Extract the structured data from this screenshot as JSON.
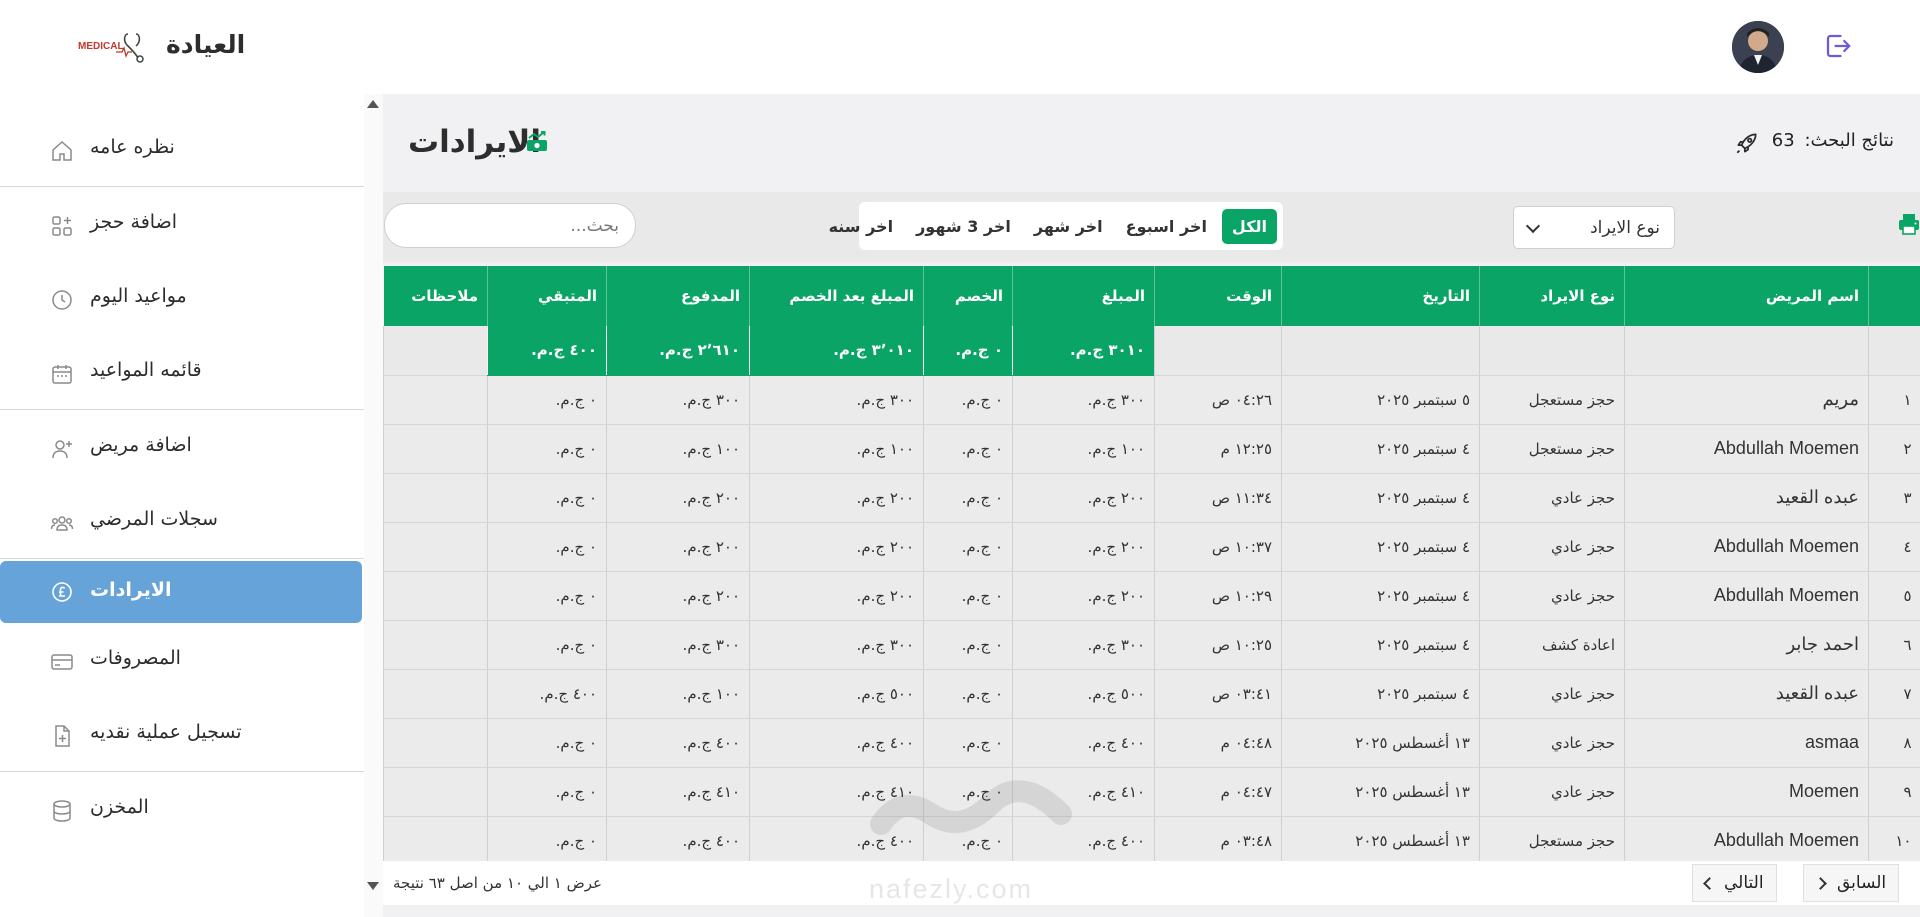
{
  "header": {
    "brand_name": "العيادة",
    "logo_text": "MEDICAL",
    "icons": {
      "logout": "logout-icon",
      "avatar": "user-avatar"
    }
  },
  "sidebar": {
    "items": [
      {
        "label": "نظره عامه",
        "icon": "home-icon"
      },
      {
        "label": "اضافة حجز",
        "icon": "grid-plus-icon"
      },
      {
        "label": "مواعيد اليوم",
        "icon": "clock-icon"
      },
      {
        "label": "قائمه المواعيد",
        "icon": "calendar-icon"
      },
      {
        "label": "اضافة مريض",
        "icon": "user-plus-icon"
      },
      {
        "label": "سجلات المرضي",
        "icon": "users-icon"
      },
      {
        "label": "الايرادات",
        "icon": "pound-coin-icon",
        "active": true
      },
      {
        "label": "المصروفات",
        "icon": "card-icon"
      },
      {
        "label": "تسجيل عملية نقديه",
        "icon": "file-plus-icon"
      },
      {
        "label": "المخزن",
        "icon": "database-icon"
      }
    ]
  },
  "main": {
    "title": "الايرادات",
    "results_label": "نتائج البحث:",
    "results_count": "63",
    "search_placeholder": "بحث...",
    "filters": [
      "الكل",
      "اخر اسبوع",
      "اخر شهر",
      "اخر 3 شهور",
      "اخر سنه"
    ],
    "active_filter": "الكل",
    "type_select": "نوع الايراد",
    "table": {
      "columns": [
        "",
        "اسم المريض",
        "نوع الايراد",
        "التاريخ",
        "الوقت",
        "المبلغ",
        "الخصم",
        "المبلغ بعد الخصم",
        "المدفوع",
        "المتبقي",
        "ملاحظات"
      ],
      "totals": {
        "amount": "٣٠١٠ ج.م.",
        "discount": "٠ ج.م.",
        "after_discount": "٣٬٠١٠ ج.م.",
        "paid": "٢٬٦١٠ ج.م.",
        "remaining": "٤٠٠ ج.م."
      },
      "rows": [
        {
          "idx": "١",
          "name": "مريم",
          "type": "حجز مستعجل",
          "date": "٥ سبتمبر ٢٠٢٥",
          "time": "٠٤:٢٦ ص",
          "amount": "٣٠٠ ج.م.",
          "discount": "٠ ج.م.",
          "after": "٣٠٠ ج.م.",
          "paid": "٣٠٠ ج.م.",
          "remaining": "٠ ج.م.",
          "notes": ""
        },
        {
          "idx": "٢",
          "name": "Abdullah Moemen",
          "type": "حجز مستعجل",
          "date": "٤ سبتمبر ٢٠٢٥",
          "time": "١٢:٢٥ م",
          "amount": "١٠٠ ج.م.",
          "discount": "٠ ج.م.",
          "after": "١٠٠ ج.م.",
          "paid": "١٠٠ ج.م.",
          "remaining": "٠ ج.م.",
          "notes": ""
        },
        {
          "idx": "٣",
          "name": "عبده القعيد",
          "type": "حجز عادي",
          "date": "٤ سبتمبر ٢٠٢٥",
          "time": "١١:٣٤ ص",
          "amount": "٢٠٠ ج.م.",
          "discount": "٠ ج.م.",
          "after": "٢٠٠ ج.م.",
          "paid": "٢٠٠ ج.م.",
          "remaining": "٠ ج.م.",
          "notes": ""
        },
        {
          "idx": "٤",
          "name": "Abdullah Moemen",
          "type": "حجز عادي",
          "date": "٤ سبتمبر ٢٠٢٥",
          "time": "١٠:٣٧ ص",
          "amount": "٢٠٠ ج.م.",
          "discount": "٠ ج.م.",
          "after": "٢٠٠ ج.م.",
          "paid": "٢٠٠ ج.م.",
          "remaining": "٠ ج.م.",
          "notes": ""
        },
        {
          "idx": "٥",
          "name": "Abdullah Moemen",
          "type": "حجز عادي",
          "date": "٤ سبتمبر ٢٠٢٥",
          "time": "١٠:٢٩ ص",
          "amount": "٢٠٠ ج.م.",
          "discount": "٠ ج.م.",
          "after": "٢٠٠ ج.م.",
          "paid": "٢٠٠ ج.م.",
          "remaining": "٠ ج.م.",
          "notes": ""
        },
        {
          "idx": "٦",
          "name": "احمد جابر",
          "type": "اعادة كشف",
          "date": "٤ سبتمبر ٢٠٢٥",
          "time": "١٠:٢٥ ص",
          "amount": "٣٠٠ ج.م.",
          "discount": "٠ ج.م.",
          "after": "٣٠٠ ج.م.",
          "paid": "٣٠٠ ج.م.",
          "remaining": "٠ ج.م.",
          "notes": ""
        },
        {
          "idx": "٧",
          "name": "عبده القعيد",
          "type": "حجز عادي",
          "date": "٤ سبتمبر ٢٠٢٥",
          "time": "٠٣:٤١ ص",
          "amount": "٥٠٠ ج.م.",
          "discount": "٠ ج.م.",
          "after": "٥٠٠ ج.م.",
          "paid": "١٠٠ ج.م.",
          "remaining": "٤٠٠ ج.م.",
          "notes": ""
        },
        {
          "idx": "٨",
          "name": "asmaa",
          "type": "حجز عادي",
          "date": "١٣ أغسطس ٢٠٢٥",
          "time": "٠٤:٤٨ م",
          "amount": "٤٠٠ ج.م.",
          "discount": "٠ ج.م.",
          "after": "٤٠٠ ج.م.",
          "paid": "٤٠٠ ج.م.",
          "remaining": "٠ ج.م.",
          "notes": ""
        },
        {
          "idx": "٩",
          "name": "Moemen",
          "type": "حجز عادي",
          "date": "١٣ أغسطس ٢٠٢٥",
          "time": "٠٤:٤٧ م",
          "amount": "٤١٠ ج.م.",
          "discount": "٠ ج.م.",
          "after": "٤١٠ ج.م.",
          "paid": "٤١٠ ج.م.",
          "remaining": "٠ ج.م.",
          "notes": ""
        },
        {
          "idx": "١٠",
          "name": "Abdullah Moemen",
          "type": "حجز مستعجل",
          "date": "١٣ أغسطس ٢٠٢٥",
          "time": "٠٣:٤٨ م",
          "amount": "٤٠٠ ج.م.",
          "discount": "٠ ج.م.",
          "after": "٤٠٠ ج.م.",
          "paid": "٤٠٠ ج.م.",
          "remaining": "٠ ج.م.",
          "notes": ""
        }
      ]
    },
    "footer": {
      "info": "عرض ١ الي ١٠ من اصل ٦٣ نتيجة",
      "prev": "السابق",
      "next": "التالي"
    },
    "watermark": "nafezly.com"
  },
  "colors": {
    "accent": "#0aa566",
    "active_menu": "#66a3d9",
    "icon_purple": "#6b5bd6"
  }
}
